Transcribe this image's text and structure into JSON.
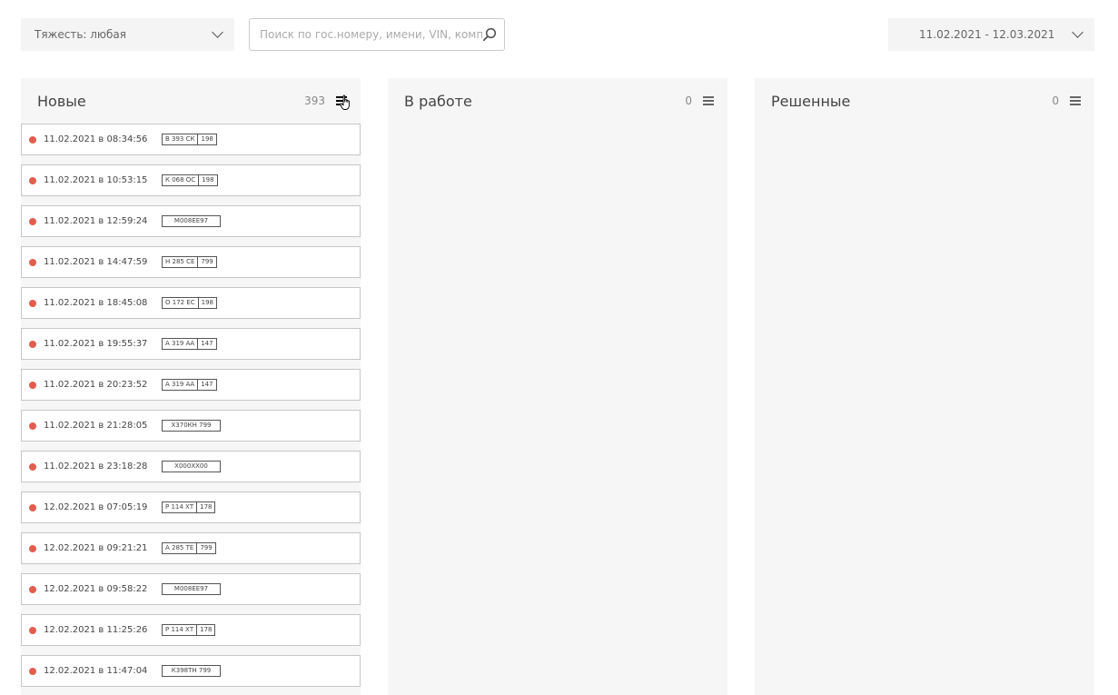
{
  "filters": {
    "severity_label": "Тяжесть: любая",
    "search_placeholder": "Поиск по гос.номеру, имени, VIN, комплекту",
    "date_range": "11.02.2021 - 12.03.2021"
  },
  "columns": {
    "new": {
      "title": "Новые",
      "count": "393"
    },
    "work": {
      "title": "В работе",
      "count": "0"
    },
    "done": {
      "title": "Решенные",
      "count": "0"
    }
  },
  "cards": [
    {
      "time": "11.02.2021 в 08:34:56",
      "plate_num": "В 393 СК",
      "plate_reg": "198",
      "plain": false
    },
    {
      "time": "11.02.2021 в 10:53:15",
      "plate_num": "К 068 ОС",
      "plate_reg": "198",
      "plain": false
    },
    {
      "time": "11.02.2021 в 12:59:24",
      "plate_num": "М008ЕЕ97",
      "plate_reg": "",
      "plain": true
    },
    {
      "time": "11.02.2021 в 14:47:59",
      "plate_num": "Н 285 СЕ",
      "plate_reg": "799",
      "plain": false
    },
    {
      "time": "11.02.2021 в 18:45:08",
      "plate_num": "О 172 ЕС",
      "plate_reg": "198",
      "plain": false
    },
    {
      "time": "11.02.2021 в 19:55:37",
      "plate_num": "А 319 АА",
      "plate_reg": "147",
      "plain": false
    },
    {
      "time": "11.02.2021 в 20:23:52",
      "plate_num": "А 319 АА",
      "plate_reg": "147",
      "plain": false
    },
    {
      "time": "11.02.2021 в 21:28:05",
      "plate_num": "Х370КН 799",
      "plate_reg": "",
      "plain": true
    },
    {
      "time": "11.02.2021 в 23:18:28",
      "plate_num": "Х000ХХ00",
      "plate_reg": "",
      "plain": true
    },
    {
      "time": "12.02.2021 в 07:05:19",
      "plate_num": "Р 114 ХТ",
      "plate_reg": "178",
      "plain": false
    },
    {
      "time": "12.02.2021 в 09:21:21",
      "plate_num": "А 285 ТЕ",
      "plate_reg": "799",
      "plain": false
    },
    {
      "time": "12.02.2021 в 09:58:22",
      "plate_num": "М008ЕЕ97",
      "plate_reg": "",
      "plain": true
    },
    {
      "time": "12.02.2021 в 11:25:26",
      "plate_num": "Р 114 ХТ",
      "plate_reg": "178",
      "plain": false
    },
    {
      "time": "12.02.2021 в 11:47:04",
      "plate_num": "К398ТН 799",
      "plate_reg": "",
      "plain": true
    }
  ],
  "colors": {
    "status_dot": "#e35d4f",
    "column_bg": "#f6f6f6"
  }
}
